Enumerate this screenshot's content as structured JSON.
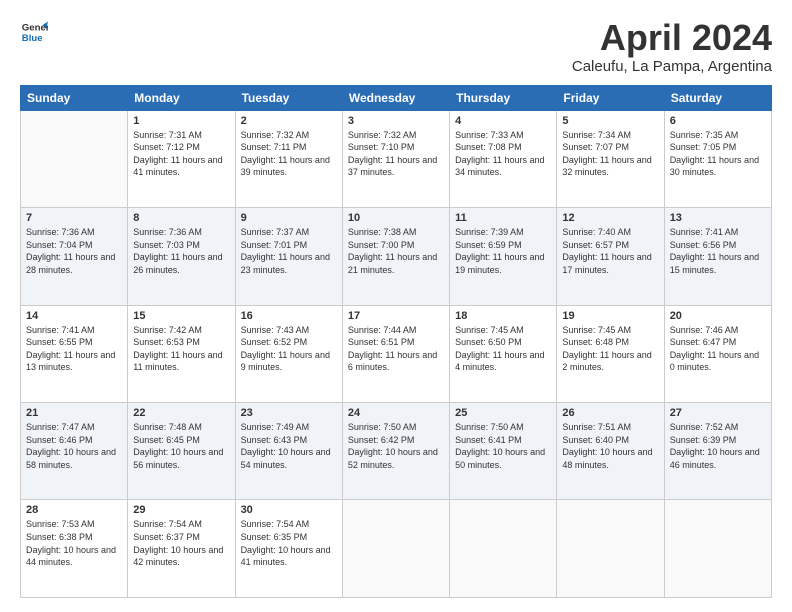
{
  "logo": {
    "line1": "General",
    "line2": "Blue"
  },
  "title": "April 2024",
  "subtitle": "Caleufu, La Pampa, Argentina",
  "days_of_week": [
    "Sunday",
    "Monday",
    "Tuesday",
    "Wednesday",
    "Thursday",
    "Friday",
    "Saturday"
  ],
  "weeks": [
    [
      {
        "day": "",
        "sunrise": "",
        "sunset": "",
        "daylight": ""
      },
      {
        "day": "1",
        "sunrise": "Sunrise: 7:31 AM",
        "sunset": "Sunset: 7:12 PM",
        "daylight": "Daylight: 11 hours and 41 minutes."
      },
      {
        "day": "2",
        "sunrise": "Sunrise: 7:32 AM",
        "sunset": "Sunset: 7:11 PM",
        "daylight": "Daylight: 11 hours and 39 minutes."
      },
      {
        "day": "3",
        "sunrise": "Sunrise: 7:32 AM",
        "sunset": "Sunset: 7:10 PM",
        "daylight": "Daylight: 11 hours and 37 minutes."
      },
      {
        "day": "4",
        "sunrise": "Sunrise: 7:33 AM",
        "sunset": "Sunset: 7:08 PM",
        "daylight": "Daylight: 11 hours and 34 minutes."
      },
      {
        "day": "5",
        "sunrise": "Sunrise: 7:34 AM",
        "sunset": "Sunset: 7:07 PM",
        "daylight": "Daylight: 11 hours and 32 minutes."
      },
      {
        "day": "6",
        "sunrise": "Sunrise: 7:35 AM",
        "sunset": "Sunset: 7:05 PM",
        "daylight": "Daylight: 11 hours and 30 minutes."
      }
    ],
    [
      {
        "day": "7",
        "sunrise": "Sunrise: 7:36 AM",
        "sunset": "Sunset: 7:04 PM",
        "daylight": "Daylight: 11 hours and 28 minutes."
      },
      {
        "day": "8",
        "sunrise": "Sunrise: 7:36 AM",
        "sunset": "Sunset: 7:03 PM",
        "daylight": "Daylight: 11 hours and 26 minutes."
      },
      {
        "day": "9",
        "sunrise": "Sunrise: 7:37 AM",
        "sunset": "Sunset: 7:01 PM",
        "daylight": "Daylight: 11 hours and 23 minutes."
      },
      {
        "day": "10",
        "sunrise": "Sunrise: 7:38 AM",
        "sunset": "Sunset: 7:00 PM",
        "daylight": "Daylight: 11 hours and 21 minutes."
      },
      {
        "day": "11",
        "sunrise": "Sunrise: 7:39 AM",
        "sunset": "Sunset: 6:59 PM",
        "daylight": "Daylight: 11 hours and 19 minutes."
      },
      {
        "day": "12",
        "sunrise": "Sunrise: 7:40 AM",
        "sunset": "Sunset: 6:57 PM",
        "daylight": "Daylight: 11 hours and 17 minutes."
      },
      {
        "day": "13",
        "sunrise": "Sunrise: 7:41 AM",
        "sunset": "Sunset: 6:56 PM",
        "daylight": "Daylight: 11 hours and 15 minutes."
      }
    ],
    [
      {
        "day": "14",
        "sunrise": "Sunrise: 7:41 AM",
        "sunset": "Sunset: 6:55 PM",
        "daylight": "Daylight: 11 hours and 13 minutes."
      },
      {
        "day": "15",
        "sunrise": "Sunrise: 7:42 AM",
        "sunset": "Sunset: 6:53 PM",
        "daylight": "Daylight: 11 hours and 11 minutes."
      },
      {
        "day": "16",
        "sunrise": "Sunrise: 7:43 AM",
        "sunset": "Sunset: 6:52 PM",
        "daylight": "Daylight: 11 hours and 9 minutes."
      },
      {
        "day": "17",
        "sunrise": "Sunrise: 7:44 AM",
        "sunset": "Sunset: 6:51 PM",
        "daylight": "Daylight: 11 hours and 6 minutes."
      },
      {
        "day": "18",
        "sunrise": "Sunrise: 7:45 AM",
        "sunset": "Sunset: 6:50 PM",
        "daylight": "Daylight: 11 hours and 4 minutes."
      },
      {
        "day": "19",
        "sunrise": "Sunrise: 7:45 AM",
        "sunset": "Sunset: 6:48 PM",
        "daylight": "Daylight: 11 hours and 2 minutes."
      },
      {
        "day": "20",
        "sunrise": "Sunrise: 7:46 AM",
        "sunset": "Sunset: 6:47 PM",
        "daylight": "Daylight: 11 hours and 0 minutes."
      }
    ],
    [
      {
        "day": "21",
        "sunrise": "Sunrise: 7:47 AM",
        "sunset": "Sunset: 6:46 PM",
        "daylight": "Daylight: 10 hours and 58 minutes."
      },
      {
        "day": "22",
        "sunrise": "Sunrise: 7:48 AM",
        "sunset": "Sunset: 6:45 PM",
        "daylight": "Daylight: 10 hours and 56 minutes."
      },
      {
        "day": "23",
        "sunrise": "Sunrise: 7:49 AM",
        "sunset": "Sunset: 6:43 PM",
        "daylight": "Daylight: 10 hours and 54 minutes."
      },
      {
        "day": "24",
        "sunrise": "Sunrise: 7:50 AM",
        "sunset": "Sunset: 6:42 PM",
        "daylight": "Daylight: 10 hours and 52 minutes."
      },
      {
        "day": "25",
        "sunrise": "Sunrise: 7:50 AM",
        "sunset": "Sunset: 6:41 PM",
        "daylight": "Daylight: 10 hours and 50 minutes."
      },
      {
        "day": "26",
        "sunrise": "Sunrise: 7:51 AM",
        "sunset": "Sunset: 6:40 PM",
        "daylight": "Daylight: 10 hours and 48 minutes."
      },
      {
        "day": "27",
        "sunrise": "Sunrise: 7:52 AM",
        "sunset": "Sunset: 6:39 PM",
        "daylight": "Daylight: 10 hours and 46 minutes."
      }
    ],
    [
      {
        "day": "28",
        "sunrise": "Sunrise: 7:53 AM",
        "sunset": "Sunset: 6:38 PM",
        "daylight": "Daylight: 10 hours and 44 minutes."
      },
      {
        "day": "29",
        "sunrise": "Sunrise: 7:54 AM",
        "sunset": "Sunset: 6:37 PM",
        "daylight": "Daylight: 10 hours and 42 minutes."
      },
      {
        "day": "30",
        "sunrise": "Sunrise: 7:54 AM",
        "sunset": "Sunset: 6:35 PM",
        "daylight": "Daylight: 10 hours and 41 minutes."
      },
      {
        "day": "",
        "sunrise": "",
        "sunset": "",
        "daylight": ""
      },
      {
        "day": "",
        "sunrise": "",
        "sunset": "",
        "daylight": ""
      },
      {
        "day": "",
        "sunrise": "",
        "sunset": "",
        "daylight": ""
      },
      {
        "day": "",
        "sunrise": "",
        "sunset": "",
        "daylight": ""
      }
    ]
  ]
}
